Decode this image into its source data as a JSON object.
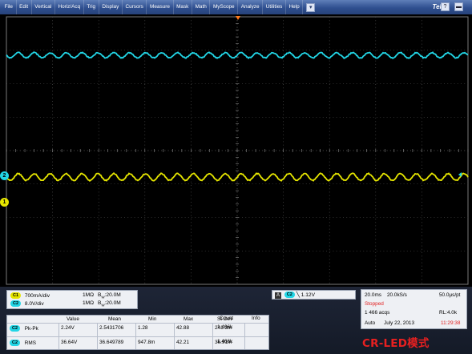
{
  "menu": {
    "items": [
      "File",
      "Edit",
      "Vertical",
      "Horiz/Acq",
      "Trig",
      "Display",
      "Cursors",
      "Measure",
      "Mask",
      "Math",
      "MyScope",
      "Analyze",
      "Utilities",
      "Help"
    ],
    "dropdown_icon": "chevron-down-icon",
    "brand": "Tek"
  },
  "markers": {
    "ch2_label": "2",
    "ch1_label": "1",
    "ch2_color": "#22d6e6",
    "ch1_color": "#e6e600",
    "trigger_color": "#ff7a1a"
  },
  "channels": [
    {
      "badge": "C1",
      "scale": "700mA/div",
      "coupling": "1MΩ",
      "bandwidth": "B",
      "bw_sub": "W",
      "bw_value": ":20.0M",
      "color": "#e6e600"
    },
    {
      "badge": "C2",
      "scale": "8.0V/div",
      "coupling": "1MΩ",
      "bandwidth": "B",
      "bw_sub": "W",
      "bw_value": ":20.0M",
      "color": "#22d6e6"
    }
  ],
  "trigger": {
    "mode_badge": "A",
    "source_badge": "C2",
    "slope_icon": "falling-edge-icon",
    "level": "1.12V"
  },
  "measurements": {
    "headers": [
      "Value",
      "Mean",
      "Min",
      "Max",
      "St Dev",
      "Count",
      "Info"
    ],
    "rows": [
      {
        "badge": "C2",
        "name": "Pk-Pk",
        "values": [
          "2.24V",
          "2.5431706",
          "1.28",
          "42.88",
          "241.3m",
          "1.466k",
          ""
        ]
      },
      {
        "badge": "C2",
        "name": "RMS",
        "values": [
          "36.64V",
          "36.649789",
          "947.8m",
          "42.21",
          "36.91m",
          "1.466k",
          ""
        ]
      }
    ]
  },
  "status": {
    "timebase": "20.0ms",
    "sample_rate": "20.0kS/s",
    "resolution": "50.0μs/pt",
    "state": "Stopped",
    "state_color": "#e22020",
    "acqs": "1 466 acqs",
    "record_length": "RL:4.0k",
    "mode": "Auto",
    "date": "July 22, 2013",
    "time": "11:29:38",
    "time_color": "#e22020"
  },
  "caption": "CR-LED模式"
}
